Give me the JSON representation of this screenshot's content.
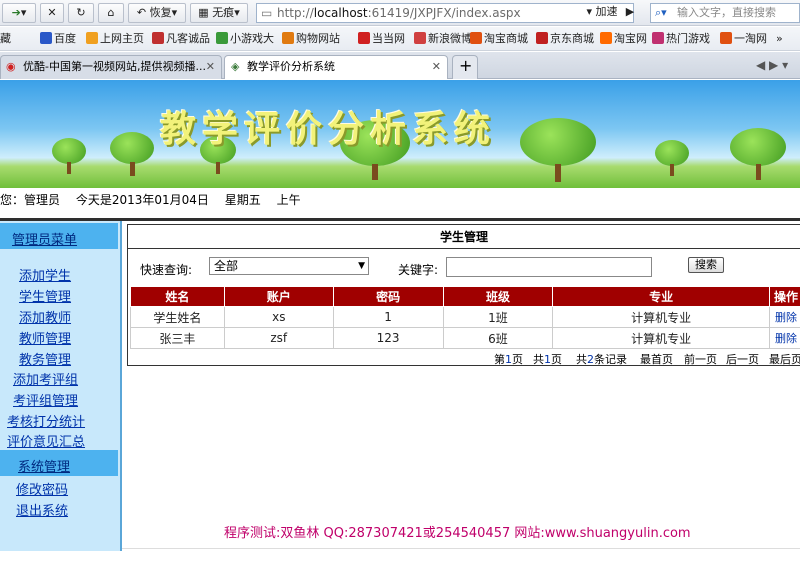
{
  "browser": {
    "back_icon": "arrow-right-icon",
    "restore_label": "恢复",
    "notrace_label": "无痕",
    "url_prefix": "http://",
    "url_host": "localhost",
    "url_rest": ":61419/JXPJFX/index.aspx",
    "speedup_label": "加速",
    "search_placeholder": "输入文字，直接搜索",
    "bookmarks": [
      {
        "label": "藏"
      },
      {
        "label": "百度"
      },
      {
        "label": "上网主页"
      },
      {
        "label": "凡客诚品"
      },
      {
        "label": "小游戏大"
      },
      {
        "label": "购物网站"
      },
      {
        "label": "当当网"
      },
      {
        "label": "新浪微博"
      },
      {
        "label": "淘宝商城"
      },
      {
        "label": "京东商城"
      },
      {
        "label": "淘宝网"
      },
      {
        "label": "热门游戏"
      },
      {
        "label": "一淘网"
      },
      {
        "label": "»"
      }
    ],
    "tabs": [
      {
        "label": "优酷-中国第一视频网站,提供视频播..."
      },
      {
        "label": "教学评价分析系统"
      }
    ],
    "new_tab_label": "+"
  },
  "banner": {
    "title": "教学评价分析系统"
  },
  "info": {
    "greeting": "您：管理员",
    "today": "今天是2013年01月04日",
    "weekday": "星期五",
    "period": "上午"
  },
  "sidebar": {
    "head1": "管理员菜单",
    "items1": [
      "添加学生",
      "学生管理",
      "添加教师",
      "教师管理",
      "教务管理",
      "添加考评组",
      "考评组管理",
      "考核打分统计",
      "评价意见汇总"
    ],
    "head2": "系统管理",
    "items2": [
      "修改密码",
      "退出系统"
    ]
  },
  "panel": {
    "title": "学生管理",
    "quick_label": "快速查询:",
    "select_value": "全部",
    "keyword_label": "关键字:",
    "search_button": "搜索",
    "columns": [
      "姓名",
      "账户",
      "密码",
      "班级",
      "专业",
      "操作"
    ],
    "rows": [
      [
        "学生姓名",
        "xs",
        "1",
        "1班",
        "计算机专业",
        "删除"
      ],
      [
        "张三丰",
        "zsf",
        "123",
        "6班",
        "计算机专业",
        "删除"
      ]
    ],
    "pager": {
      "page_pre": "第",
      "page_num": "1",
      "page_post": "页",
      "total_pre": "共",
      "total_num": "1",
      "total_post": "页",
      "records_pre": "共",
      "records_num": "2",
      "records_post": "条记录",
      "first": "最首页",
      "prev": "前一页",
      "next": "后一页",
      "last": "最后页"
    }
  },
  "footer": {
    "text": "程序测试:双鱼林 QQ:287307421或254540457 网站:www.shuangyulin.com"
  },
  "colors": {
    "header_red": "#a00000",
    "sidebar_bg": "#c8e8fb",
    "menu_head": "#4db2ef",
    "link_blue": "#0033aa"
  }
}
